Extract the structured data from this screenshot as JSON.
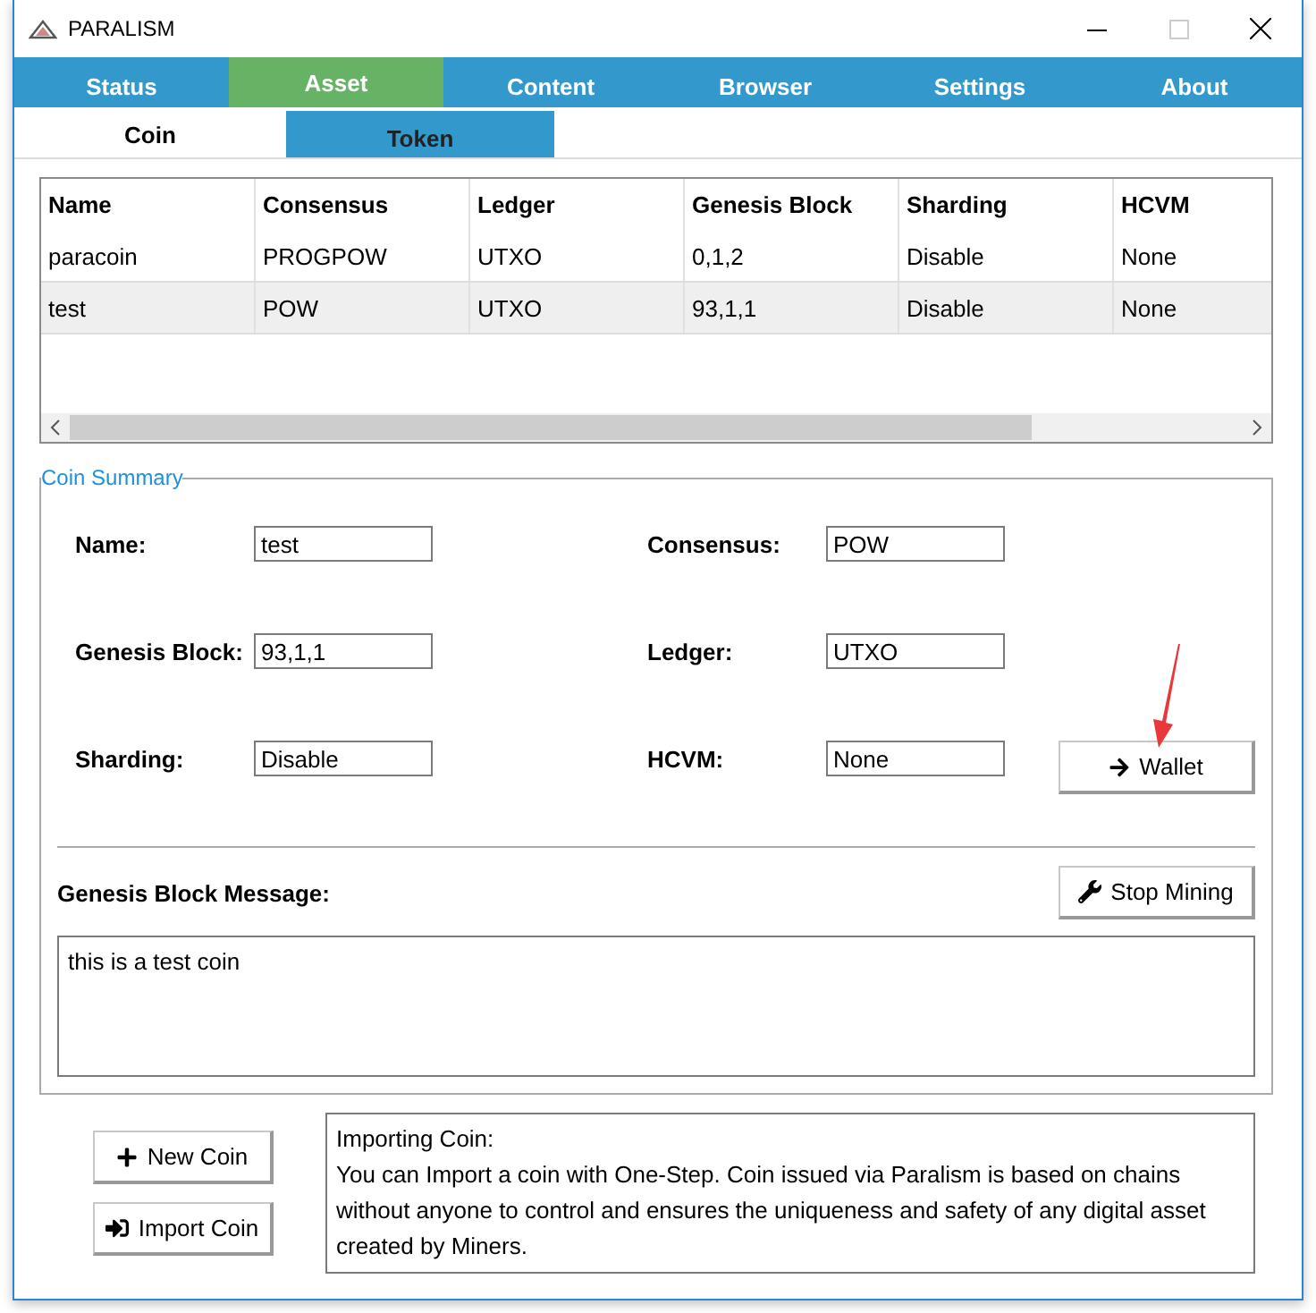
{
  "window": {
    "title": "PARALISM"
  },
  "main_tabs": [
    {
      "label": "Status",
      "selected": false
    },
    {
      "label": "Asset",
      "selected": true
    },
    {
      "label": "Content",
      "selected": false
    },
    {
      "label": "Browser",
      "selected": false
    },
    {
      "label": "Settings",
      "selected": false
    },
    {
      "label": "About",
      "selected": false
    }
  ],
  "sub_tabs": [
    {
      "label": "Coin",
      "selected": true
    },
    {
      "label": "Token",
      "selected": false
    }
  ],
  "coin_table": {
    "columns": [
      "Name",
      "Consensus",
      "Ledger",
      "Genesis Block",
      "Sharding",
      "HCVM"
    ],
    "rows": [
      {
        "cells": [
          "paracoin",
          "PROGPOW",
          "UTXO",
          "0,1,2",
          "Disable",
          "None"
        ],
        "selected": false
      },
      {
        "cells": [
          "test",
          "POW",
          "UTXO",
          "93,1,1",
          "Disable",
          "None"
        ],
        "selected": true
      }
    ]
  },
  "coin_summary": {
    "title": "Coin Summary",
    "fields": [
      {
        "label": "Name:",
        "value": "test"
      },
      {
        "label": "Consensus:",
        "value": "POW"
      },
      {
        "label": "Genesis Block:",
        "value": "93,1,1"
      },
      {
        "label": "Ledger:",
        "value": "UTXO"
      },
      {
        "label": "Sharding:",
        "value": "Disable"
      },
      {
        "label": "HCVM:",
        "value": "None"
      }
    ],
    "wallet_button": "Wallet",
    "message_label": "Genesis Block Message:",
    "stop_mining_button": "Stop Mining",
    "message": "this is a test coin"
  },
  "actions": [
    {
      "label": "New Coin",
      "kind": "new"
    },
    {
      "label": "Import Coin",
      "kind": "import"
    }
  ],
  "info": {
    "title": "Importing Coin:",
    "text": "You can Import a coin with One-Step. Coin issued via Paralism is based on chains without anyone to control and ensures the uniqueness and safety of any digital asset created by Miners."
  }
}
